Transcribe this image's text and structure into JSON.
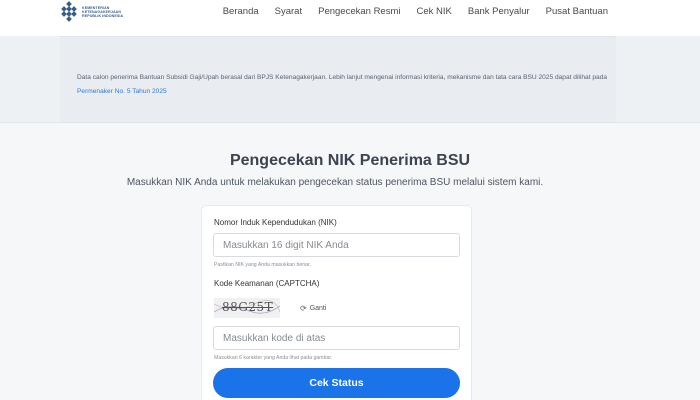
{
  "header": {
    "logo_lines": [
      "KEMENTERIAN",
      "KETENAGAKERJAAN",
      "REPUBLIK INDONESIA"
    ],
    "nav": [
      "Beranda",
      "Syarat",
      "Pengecekan Resmi",
      "Cek NIK",
      "Bank Penyalur",
      "Pusat Bantuan"
    ]
  },
  "notice": {
    "text": "Data calon penerima Bantuan Subsidi Gaji/Upah berasal dari BPJS Ketenagakerjaan. Lebih lanjut mengenai informasi kriteria, mekanisme dan tata cara BSU 2025 dapat dilihat pada ",
    "link": "Permenaker No. 5 Tahun 2025"
  },
  "main": {
    "title": "Pengecekan NIK Penerima BSU",
    "subtitle": "Masukkan NIK Anda untuk melakukan pengecekan status penerima BSU melalui sistem kami."
  },
  "form": {
    "nik_label": "Nomor Induk Kependudukan (NIK)",
    "nik_placeholder": "Masukkan 16 digit NIK Anda",
    "nik_hint": "Pastikan NIK yang Anda masukkan benar.",
    "captcha_label": "Kode Keamanan (CAPTCHA)",
    "captcha_text": "88G25T",
    "refresh_icon": "refresh-icon",
    "refresh_label": "Ganti",
    "captcha_placeholder": "Masukkan kode di atas",
    "captcha_hint": "Masukkan 6 karakter yang Anda lihat pada gambar.",
    "submit_label": "Cek Status"
  },
  "colors": {
    "primary": "#1a73e8",
    "link": "#2d7bd6",
    "logo": "#3b5c86"
  }
}
